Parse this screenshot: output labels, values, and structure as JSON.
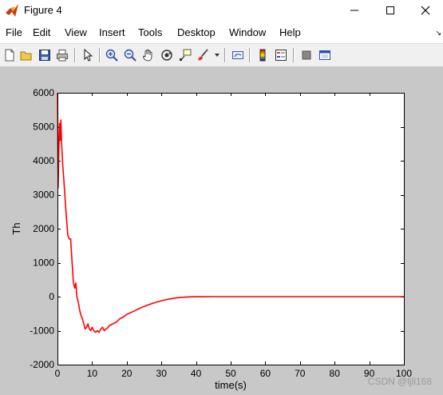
{
  "window": {
    "title": "Figure 4",
    "controls": {
      "minimize": "—",
      "maximize": "☐",
      "close": "✕"
    }
  },
  "menu": {
    "items": [
      "File",
      "Edit",
      "View",
      "Insert",
      "Tools",
      "Desktop",
      "Window",
      "Help"
    ],
    "dock_arrow": "↘"
  },
  "toolbar": {
    "buttons": [
      "new-figure-icon",
      "open-file-icon",
      "save-icon",
      "print-icon",
      "edit-plot-arrow-icon",
      "zoom-in-icon",
      "zoom-out-icon",
      "pan-hand-icon",
      "rotate-3d-icon",
      "data-cursor-icon",
      "brush-icon",
      "link-plot-icon",
      "insert-colorbar-icon",
      "insert-legend-icon",
      "hide-plot-tools-icon",
      "show-plot-tools-icon"
    ]
  },
  "chart_data": {
    "type": "line",
    "title": "",
    "xlabel": "time(s)",
    "ylabel": "Th",
    "xlim": [
      0,
      100
    ],
    "ylim": [
      -2000,
      6000
    ],
    "xticks": [
      0,
      10,
      20,
      30,
      40,
      50,
      60,
      70,
      80,
      90,
      100
    ],
    "yticks": [
      -2000,
      -1000,
      0,
      1000,
      2000,
      3000,
      4000,
      5000,
      6000
    ],
    "grid": false,
    "series": [
      {
        "color": "#ff0000",
        "x": [
          0,
          0.2,
          0.4,
          0.6,
          0.8,
          1.0,
          1.2,
          1.5,
          1.8,
          2.2,
          2.6,
          3.0,
          3.4,
          3.8,
          4.2,
          4.6,
          5.0,
          5.3,
          5.6,
          6.0,
          6.4,
          6.8,
          7.2,
          7.6,
          8.0,
          8.4,
          8.8,
          9.2,
          9.6,
          10.0,
          10.5,
          11.0,
          11.5,
          12.0,
          12.5,
          13.0,
          13.5,
          14.0,
          14.5,
          15.0,
          16.0,
          17.0,
          18.0,
          19.0,
          20.0,
          22.0,
          24.0,
          26.0,
          28.0,
          30.0,
          32.0,
          34.0,
          36.0,
          38.0,
          40.0,
          45.0,
          50.0,
          60.0,
          70.0,
          80.0,
          90.0,
          100.0
        ],
        "y": [
          6000,
          3200,
          4300,
          5100,
          4600,
          5200,
          4500,
          3900,
          3500,
          2900,
          2300,
          1800,
          1700,
          1700,
          1050,
          400,
          250,
          400,
          0,
          -150,
          -400,
          -550,
          -650,
          -800,
          -950,
          -900,
          -800,
          -950,
          -1000,
          -900,
          -1000,
          -1050,
          -1000,
          -1050,
          -950,
          -900,
          -1000,
          -950,
          -920,
          -850,
          -800,
          -750,
          -650,
          -600,
          -520,
          -430,
          -330,
          -250,
          -180,
          -120,
          -75,
          -40,
          -18,
          -8,
          -3,
          0,
          0,
          0,
          0,
          0,
          0,
          0
        ]
      }
    ]
  },
  "watermark": "CSDN @ljll168"
}
